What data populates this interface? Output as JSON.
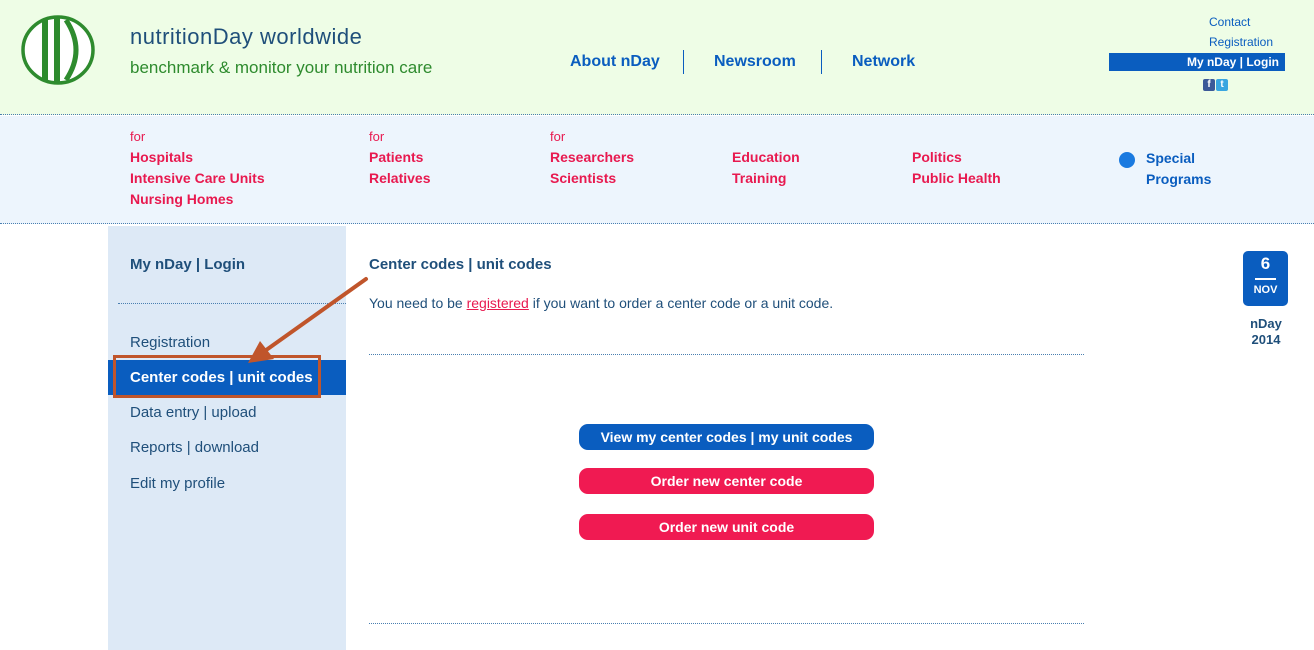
{
  "brand": {
    "name": "nutritionDay worldwide",
    "tagline": "benchmark & monitor your nutrition care"
  },
  "topnav": {
    "about": "About nDay",
    "newsroom": "Newsroom",
    "network": "Network"
  },
  "utility": {
    "contact": "Contact",
    "registration": "Registration",
    "login": "My nDay | Login",
    "social": [
      "facebook-icon",
      "twitter-icon"
    ]
  },
  "audience": {
    "group1": {
      "for": "for",
      "lines": [
        "Hospitals",
        "Intensive Care Units",
        "Nursing Homes"
      ]
    },
    "group2": {
      "for": "for",
      "lines": [
        "Patients",
        "Relatives"
      ]
    },
    "group3": {
      "for": "for",
      "lines": [
        "Researchers",
        "Scientists"
      ]
    },
    "group4": {
      "lines": [
        "Education",
        "Training"
      ]
    },
    "group5": {
      "lines": [
        "Politics",
        "Public Health"
      ]
    },
    "special": [
      "Special",
      "Programs"
    ]
  },
  "sidebar": {
    "title": "My nDay | Login",
    "items": [
      {
        "label": "Registration"
      },
      {
        "label": "Center codes | unit codes",
        "active": true
      },
      {
        "label": "Data entry | upload"
      },
      {
        "label": "Reports | download"
      },
      {
        "label": "Edit my profile"
      }
    ]
  },
  "content": {
    "title": "Center codes | unit codes",
    "text_before": "You need to be ",
    "text_link": "registered",
    "text_after": " if you want to order a center code or a unit code.",
    "buttons": {
      "view": "View my center codes | my unit codes",
      "order_center": "Order new center code",
      "order_unit": "Order new unit code"
    }
  },
  "date_badge": {
    "day": "6",
    "month": "NOV",
    "label_line1": "nDay",
    "label_line2": "2014"
  },
  "colors": {
    "accent_blue": "#0a5dbf",
    "accent_red": "#f01a52",
    "annotation": "#c0552b"
  }
}
